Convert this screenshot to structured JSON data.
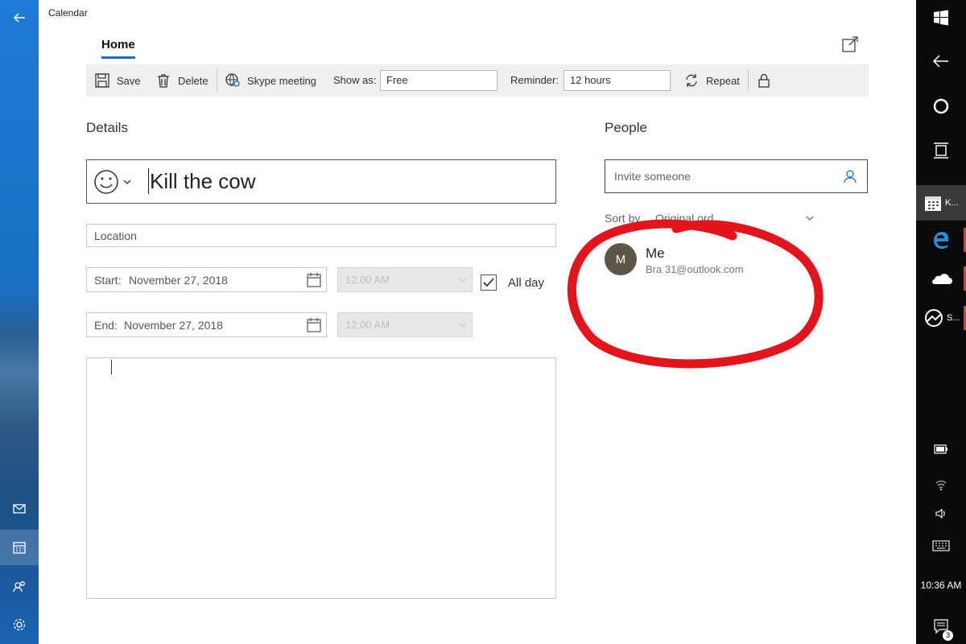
{
  "app": {
    "title": "Calendar"
  },
  "tabs": [
    {
      "label": "Home",
      "active": true
    }
  ],
  "toolbar": {
    "save_label": "Save",
    "delete_label": "Delete",
    "skype_label": "Skype meeting",
    "show_as_label": "Show as:",
    "show_as_value": "Free",
    "reminder_label": "Reminder:",
    "reminder_value": "12 hours",
    "repeat_label": "Repeat"
  },
  "details": {
    "heading": "Details",
    "event_title": "Kill the cow",
    "location_placeholder": "Location",
    "start_label": "Start:",
    "start_date": "November 27, 2018",
    "start_time": "12:00 AM",
    "end_label": "End:",
    "end_date": "November 27, 2018",
    "end_time": "12:00 AM",
    "all_day_label": "All day",
    "all_day_checked": true,
    "notes": ""
  },
  "people": {
    "heading": "People",
    "invite_placeholder": "Invite someone",
    "sort_label": "Sort by",
    "sort_value": "Original ord",
    "attendees": [
      {
        "initial": "M",
        "name": "Me",
        "email": "Bra          31@outlook.com"
      }
    ]
  },
  "taskbar": {
    "apps": [
      {
        "label": "K..."
      },
      {
        "label": "S..."
      }
    ],
    "time": "10:36 AM",
    "notification_count": "3"
  },
  "colors": {
    "accent": "#1f6fbf",
    "annotation": "#e3141b",
    "avatar": "#5d5545"
  },
  "icons": [
    "back-arrow-icon",
    "save-icon",
    "delete-icon",
    "skype-icon",
    "repeat-icon",
    "lock-icon",
    "popout-icon",
    "emoji-icon",
    "calendar-icon",
    "person-icon",
    "mail-icon",
    "people-icon",
    "gear-icon",
    "windows-icon",
    "cortana-icon",
    "task-view-icon",
    "edge-icon",
    "onedrive-icon",
    "battery-icon",
    "wifi-icon",
    "volume-icon",
    "keyboard-icon",
    "action-center-icon"
  ]
}
